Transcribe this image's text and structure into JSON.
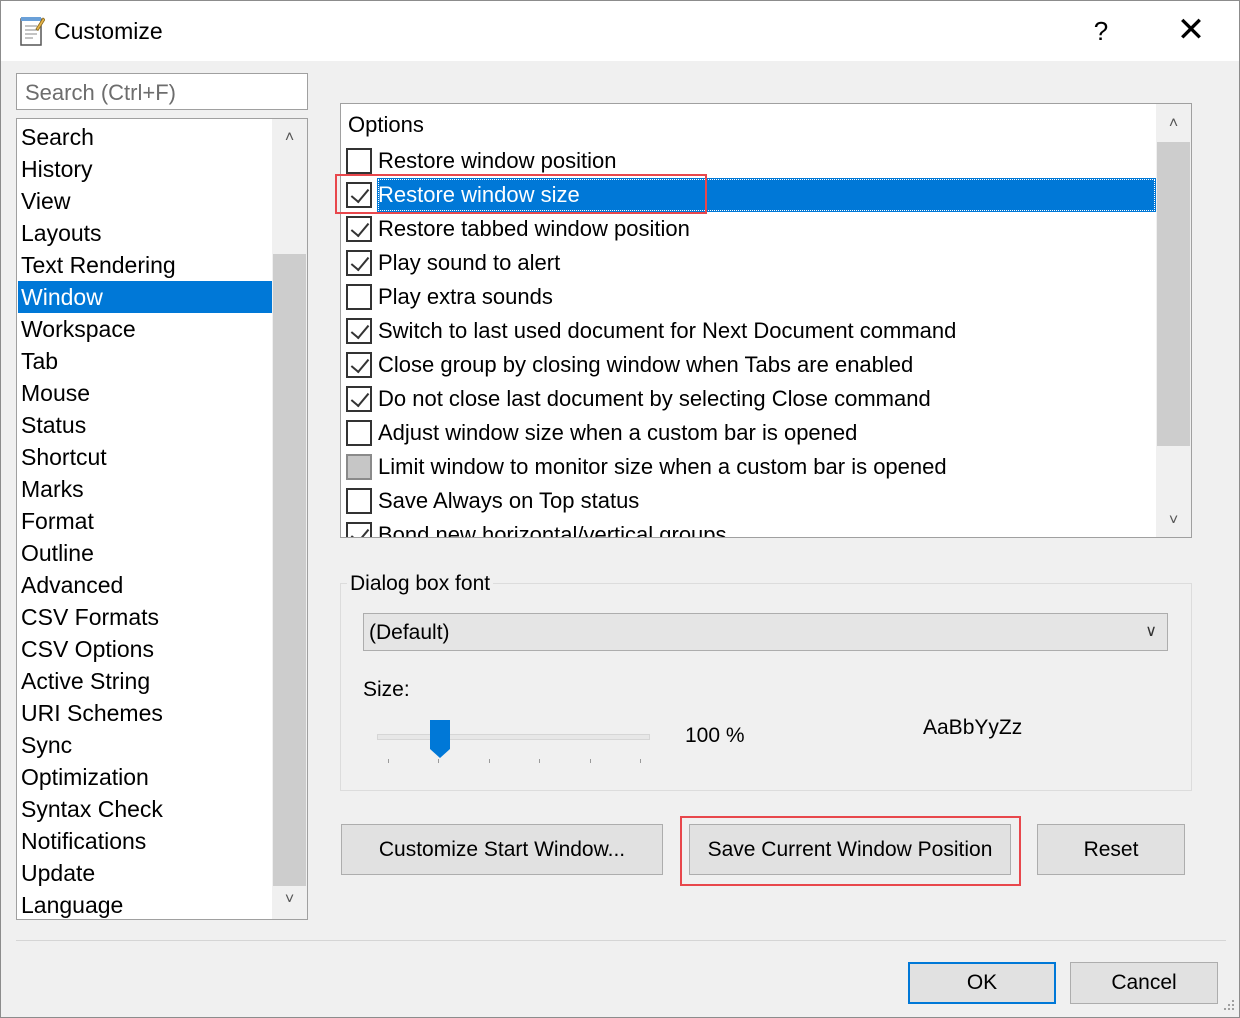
{
  "window": {
    "title": "Customize",
    "help_label": "?",
    "close_label": "✕"
  },
  "search": {
    "placeholder": "Search (Ctrl+F)"
  },
  "categories": [
    "Search",
    "History",
    "View",
    "Layouts",
    "Text Rendering",
    "Window",
    "Workspace",
    "Tab",
    "Mouse",
    "Status",
    "Shortcut",
    "Marks",
    "Format",
    "Outline",
    "Advanced",
    "CSV Formats",
    "CSV Options",
    "Active String",
    "URI Schemes",
    "Sync",
    "Optimization",
    "Syntax Check",
    "Notifications",
    "Update",
    "Language"
  ],
  "selected_category": "Window",
  "options": {
    "header": "Options",
    "items": [
      {
        "label": "Restore window position",
        "state": "unchecked"
      },
      {
        "label": "Restore window size",
        "state": "checked",
        "selected": true
      },
      {
        "label": "Restore tabbed window position",
        "state": "checked"
      },
      {
        "label": "Play sound to alert",
        "state": "checked"
      },
      {
        "label": "Play extra sounds",
        "state": "unchecked"
      },
      {
        "label": "Switch to last used document for Next Document command",
        "state": "checked"
      },
      {
        "label": "Close group by closing window when Tabs are enabled",
        "state": "checked"
      },
      {
        "label": "Do not close last document by selecting Close command",
        "state": "checked"
      },
      {
        "label": "Adjust window size when a custom bar is opened",
        "state": "unchecked"
      },
      {
        "label": "Limit window to monitor size when a custom bar is opened",
        "state": "indeterminate"
      },
      {
        "label": "Save Always on Top status",
        "state": "unchecked"
      },
      {
        "label": "Bond new horizontal/vertical groups",
        "state": "checked"
      }
    ]
  },
  "font_group": {
    "label": "Dialog box font",
    "selected_font": "(Default)",
    "size_label": "Size:",
    "size_value": "100 %",
    "size_fraction": 0.23,
    "preview": "AaBbYyZz"
  },
  "buttons": {
    "customize_start": "Customize Start Window...",
    "save_position": "Save Current Window Position",
    "reset": "Reset",
    "ok": "OK",
    "cancel": "Cancel"
  },
  "colors": {
    "selection": "#0078d7",
    "highlight_box": "#e8474c"
  }
}
